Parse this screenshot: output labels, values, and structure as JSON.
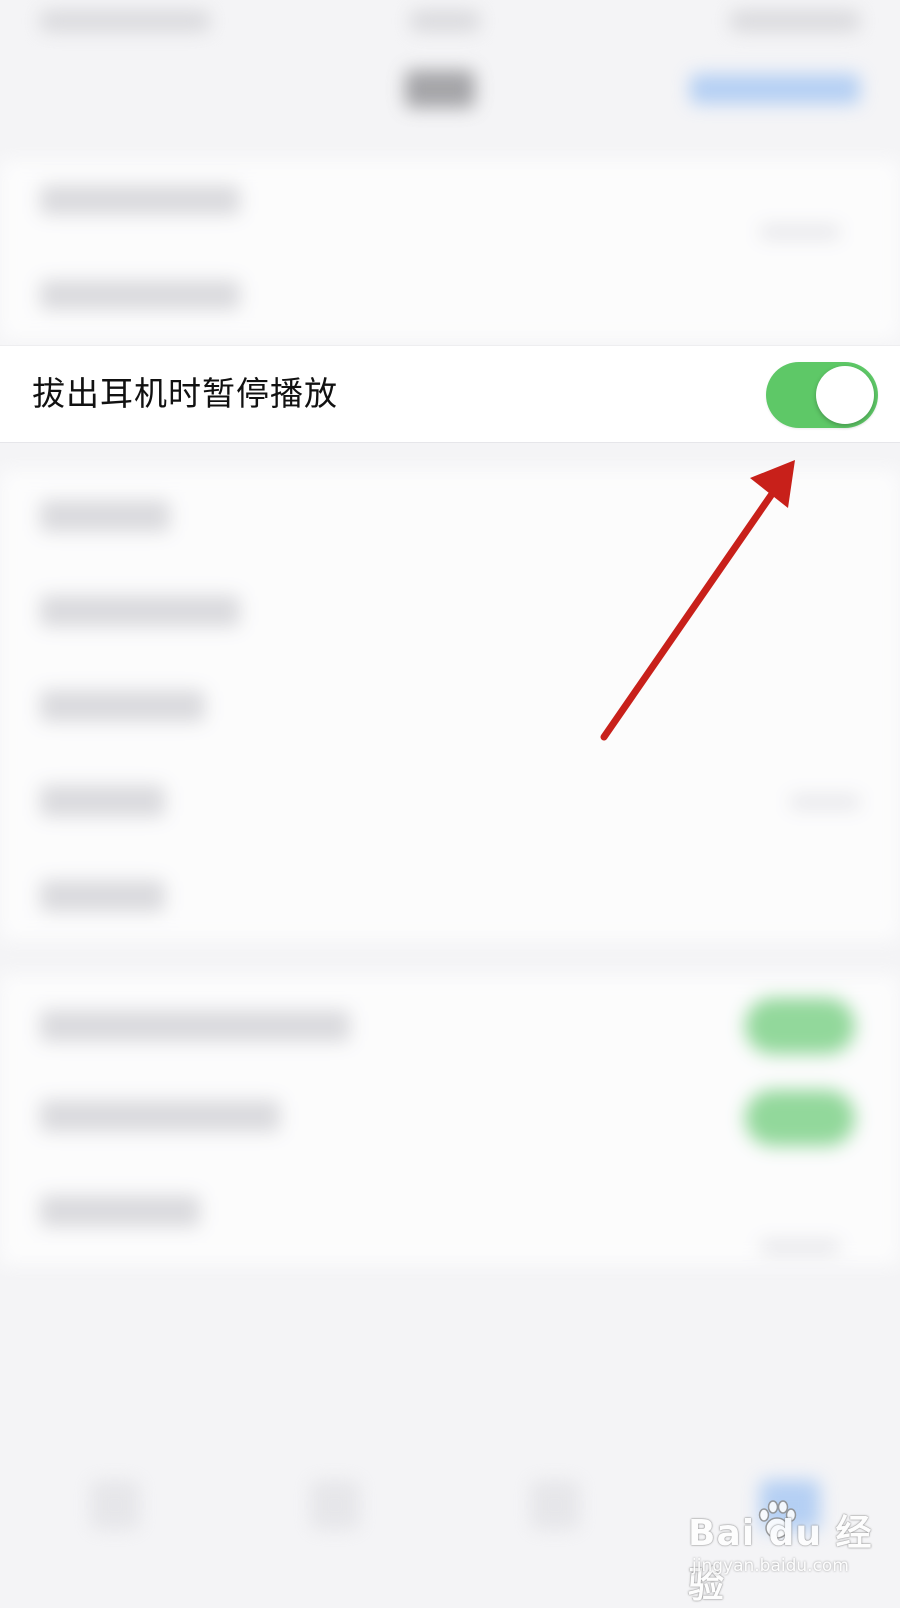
{
  "settings_row": {
    "label": "拔出耳机时暂停播放",
    "toggle_on": true
  },
  "watermark": {
    "brand": "Bai du 经验",
    "url": "jingyan.baidu.com"
  },
  "colors": {
    "toggle_on": "#5ec867",
    "arrow": "#c8201a",
    "background": "#f4f4f6"
  }
}
